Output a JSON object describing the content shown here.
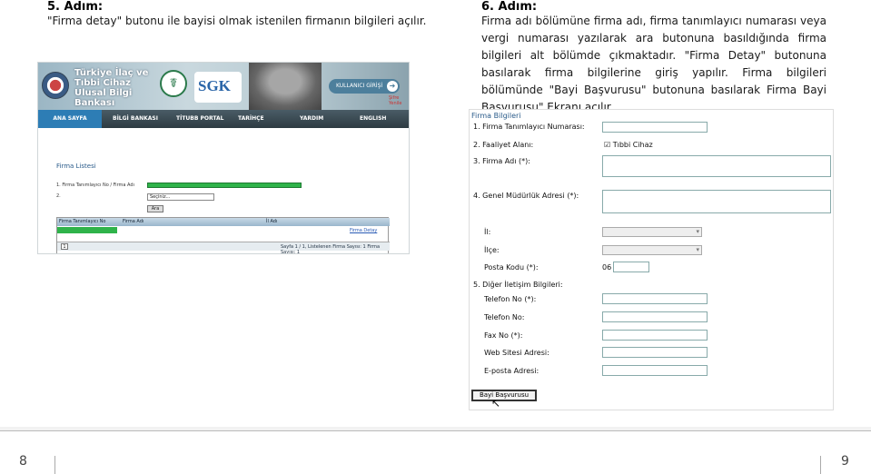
{
  "step5": {
    "heading": "5. Adım:",
    "text": "\"Firma detay\" butonu ile bayisi olmak istenilen firmanın bilgileri açılır."
  },
  "step6": {
    "heading": "6. Adım:",
    "text": "Firma adı bölümüne firma adı, firma tanımlayıcı numarası veya vergi numarası yazılarak ara butonuna basıldığında firma bilgileri alt bölümde çıkmaktadır. \"Firma Detay\" butonuna basılarak firma bilgilerine giriş yapılır. Firma bilgileri bölümünde \"Bayi Başvurusu\" butonuna basılarak Firma Bayi Başvurusu\" Ekranı açılır."
  },
  "screenshot1": {
    "banner_title": "Türkiye İlaç ve Tıbbi Cihaz Ulusal Bilgi Bankası",
    "sgk": "SGK",
    "login": "KULLANICI GİRİŞİ",
    "forgot": "Şifre Yenile",
    "nav": [
      "ANA SAYFA",
      "BİLGİ BANKASI",
      "TİTUBB PORTAL",
      "TARİHÇE",
      "YARDIM",
      "ENGLISH"
    ],
    "list_title": "Firma Listesi",
    "row1_label": "1.   Firma Tanımlayıcı No / Firma Adı",
    "row2_label": "2.",
    "select_value": "Seçiniz...",
    "search_button": "Ara",
    "table_headers": [
      "Firma Tanımlayıcı No",
      "Firma Adı",
      "İl Adı"
    ],
    "detail_link": "Firma Detay",
    "page_input": "1",
    "pagination": "Sayfa 1 / 1, Listelenen Firma Sayısı: 1 Firma Sayısı: 1"
  },
  "screenshot2": {
    "section_title": "Firma Bilgileri",
    "labels": {
      "tanimlayici": "1.   Firma Tanımlayıcı Numarası:",
      "faaliyet": "2.   Faaliyet Alanı:",
      "firma_adi": "3.   Firma Adı (*):",
      "adres": "4.   Genel Müdürlük Adresi (*):",
      "il": "İl:",
      "ilce": "İlçe:",
      "posta": "Posta Kodu (*):",
      "diger": "5.   Diğer İletişim Bilgileri:",
      "telefon": "Telefon No (*):",
      "telefon2": "Telefon No:",
      "fax": "Fax No (*):",
      "web": "Web Sitesi Adresi:",
      "eposta": "E-posta Adresi:"
    },
    "faaliyet_value": "Tıbbi Cihaz",
    "posta_prefix": "06",
    "bayi_button": "Bayi Başvurusu"
  },
  "footer": {
    "left_page": "8",
    "right_page": "9"
  }
}
